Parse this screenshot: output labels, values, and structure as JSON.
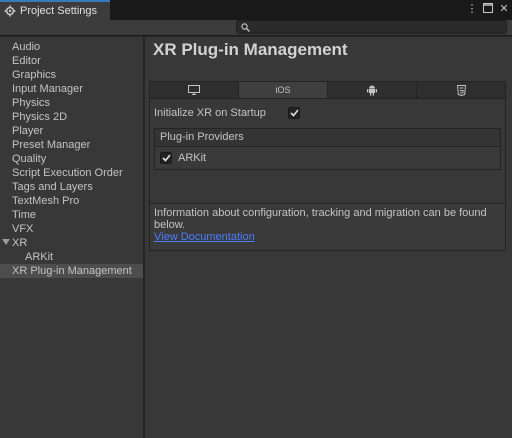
{
  "window": {
    "title": "Project Settings",
    "controls": [
      "kebab-menu-icon",
      "maximize-icon",
      "close-icon"
    ]
  },
  "search": {
    "placeholder": ""
  },
  "sidebar": {
    "items": [
      {
        "label": "Audio"
      },
      {
        "label": "Editor"
      },
      {
        "label": "Graphics"
      },
      {
        "label": "Input Manager"
      },
      {
        "label": "Physics"
      },
      {
        "label": "Physics 2D"
      },
      {
        "label": "Player"
      },
      {
        "label": "Preset Manager"
      },
      {
        "label": "Quality"
      },
      {
        "label": "Script Execution Order"
      },
      {
        "label": "Tags and Layers"
      },
      {
        "label": "TextMesh Pro"
      },
      {
        "label": "Time"
      },
      {
        "label": "VFX"
      },
      {
        "label": "XR",
        "expanded": true
      },
      {
        "label": "ARKit"
      },
      {
        "label": "XR Plug-in Management",
        "selected": true
      }
    ]
  },
  "main": {
    "title": "XR Plug-in Management",
    "platform_tabs": [
      {
        "icon": "monitor-icon",
        "label": ""
      },
      {
        "icon": "",
        "label": "iOS",
        "active": true
      },
      {
        "icon": "android-icon",
        "label": ""
      },
      {
        "icon": "html5-icon",
        "label": ""
      }
    ],
    "init_label": "Initialize XR on Startup",
    "init_checked": true,
    "providers_header": "Plug-in Providers",
    "providers": [
      {
        "label": "ARKit",
        "checked": true
      }
    ],
    "info_text": "Information about configuration, tracking and migration can be found below.",
    "info_link": "View Documentation"
  },
  "colors": {
    "selection_tab_accent": "#3a79bb",
    "link": "#4c7eff",
    "background": "#383838"
  }
}
